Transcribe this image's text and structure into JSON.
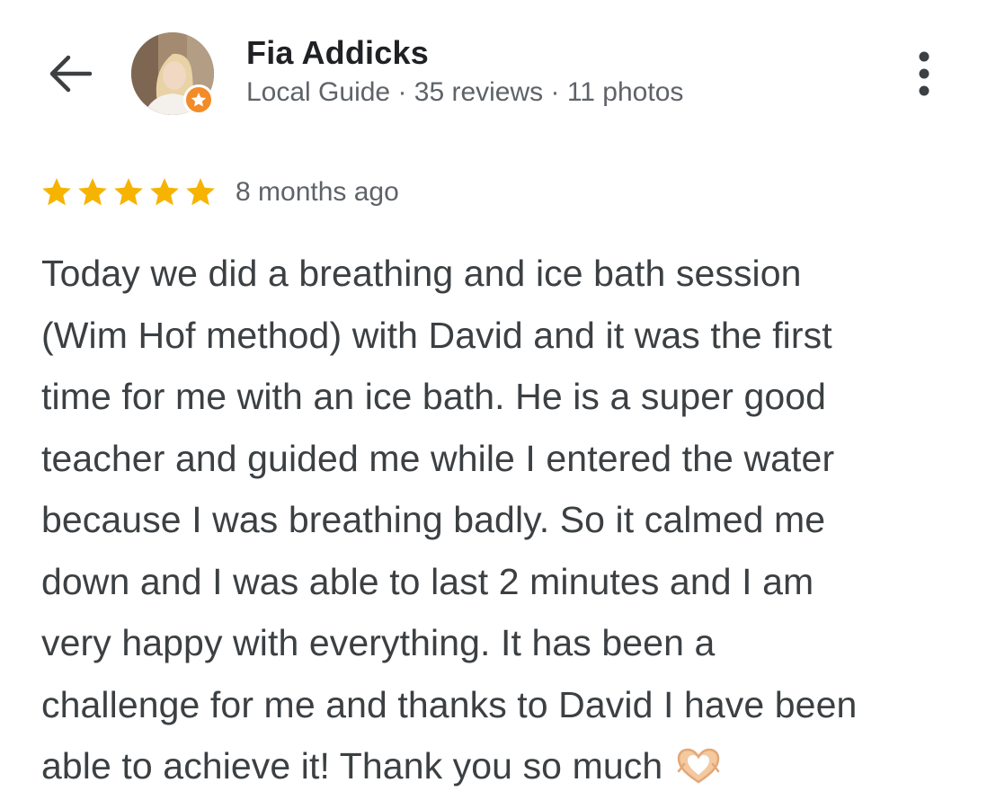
{
  "header": {
    "back_icon": "arrow-left-icon",
    "reviewer_name": "Fia Addicks",
    "reviewer_meta": "Local Guide · 35 reviews · 11 photos",
    "badge_icon": "local-guide-star-badge-icon",
    "menu_icon": "more-vert-icon"
  },
  "review": {
    "rating": 5,
    "rating_max": 5,
    "time_ago": "8 months ago",
    "lines": [
      "Today we did a breathing and ice bath session",
      "(Wim Hof method) with David and it was the first",
      "time for me with an ice bath. He is a super good",
      "teacher and guided me while I entered the water",
      "because I was breathing badly. So it calmed me",
      "down and I was able to last 2 minutes and I am",
      "very happy with everything. It has been a",
      "challenge for me and thanks to David I have been",
      "able to achieve it! Thank you so much"
    ],
    "trailing_emoji_icon": "heart-hands-emoji-icon"
  },
  "colors": {
    "star": "#F6B400",
    "badge": "#F28B28",
    "name_text": "#202124",
    "meta_text": "#5F6368",
    "body_text": "#3C4043"
  }
}
